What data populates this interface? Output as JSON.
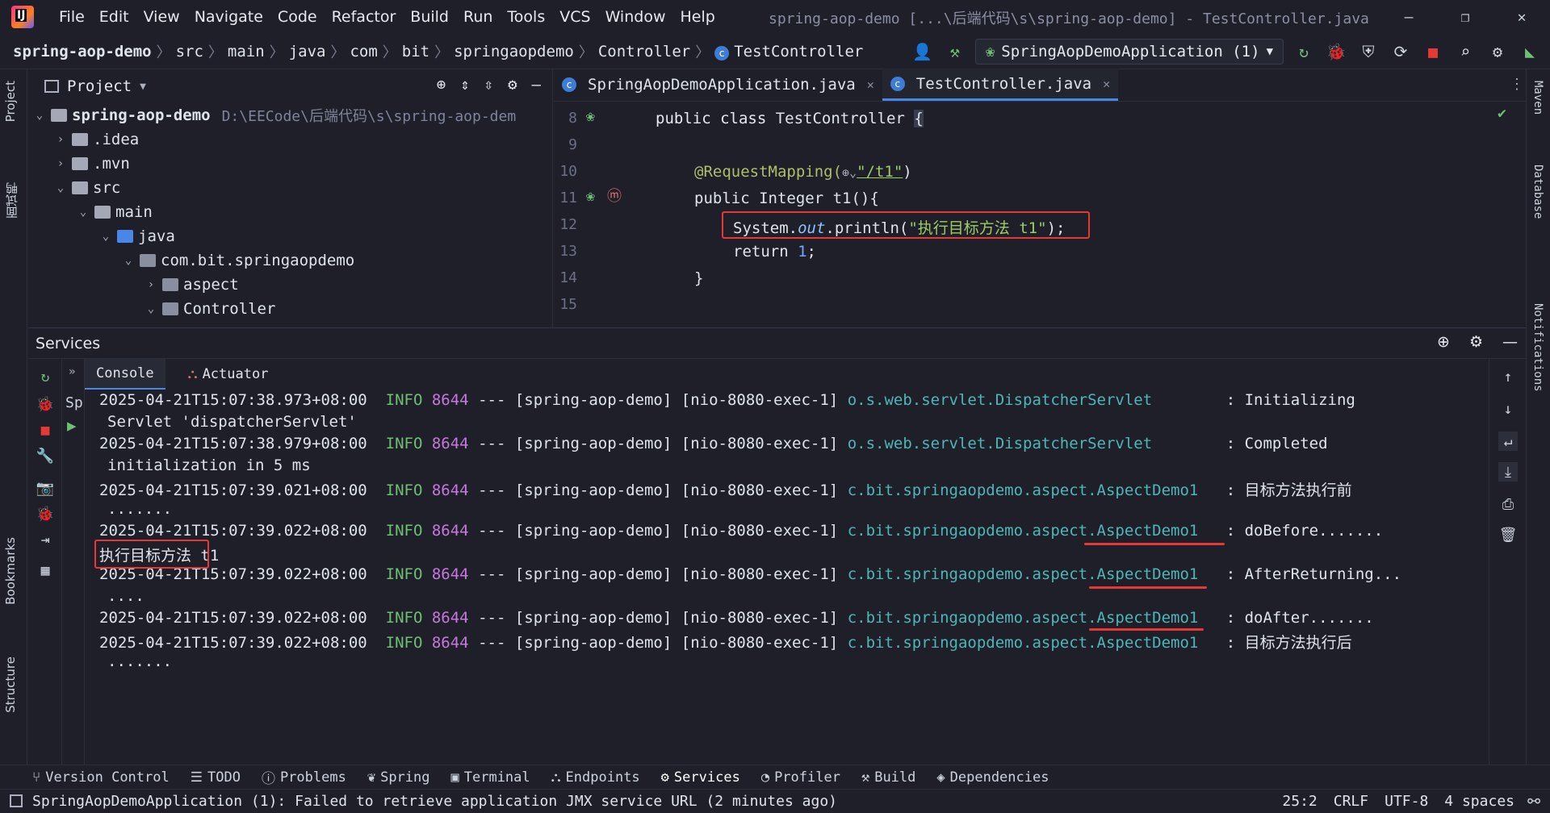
{
  "window": {
    "title": "spring-aop-demo [...\\后端代码\\s\\spring-aop-demo] - TestController.java",
    "menu": [
      "File",
      "Edit",
      "View",
      "Navigate",
      "Code",
      "Refactor",
      "Build",
      "Run",
      "Tools",
      "VCS",
      "Window",
      "Help"
    ]
  },
  "breadcrumb": [
    "spring-aop-demo",
    "src",
    "main",
    "java",
    "com",
    "bit",
    "springaopdemo",
    "Controller",
    "TestController"
  ],
  "toolbar": {
    "run_config": "SpringAopDemoApplication (1)"
  },
  "left_stripe": {
    "project": "Project",
    "interview": "面试鸭",
    "bookmarks": "Bookmarks",
    "structure": "Structure"
  },
  "right_stripe": {
    "maven": "Maven",
    "database": "Database",
    "notifications": "Notifications"
  },
  "project_panel": {
    "title": "Project",
    "root_name": "spring-aop-demo",
    "root_path": "D:\\EECode\\后端代码\\s\\spring-aop-dem",
    "items": [
      ".idea",
      ".mvn",
      "src",
      "main",
      "java",
      "com.bit.springaopdemo",
      "aspect",
      "Controller"
    ]
  },
  "editor": {
    "tabs": [
      "SpringAopDemoApplication.java",
      "TestController.java"
    ],
    "line_numbers": [
      "8",
      "9",
      "10",
      "11",
      "12",
      "13",
      "14",
      "15"
    ],
    "code": {
      "l8_a": "public class ",
      "l8_b": "TestController ",
      "l8_c": "{",
      "l10_a": "@RequestMapping(",
      "l10_b": "\"/t1\"",
      "l10_c": ")",
      "l11_a": "public ",
      "l11_b": "Integer ",
      "l11_c": "t1(){",
      "l12_a": "System.",
      "l12_b": "out",
      "l12_c": ".println(",
      "l12_d": "\"执行目标方法 t1\"",
      "l12_e": ");",
      "l13_a": "return ",
      "l13_b": "1",
      "l13_c": ";",
      "l14": "}"
    }
  },
  "services": {
    "title": "Services",
    "subtabs": [
      "Console",
      "Actuator"
    ],
    "tree_label": "Sp",
    "log": [
      {
        "ts": "2025-04-21T15:07:38.973+08:00",
        "level": "INFO",
        "pid": "8644",
        "sep": "---",
        "app": "[spring-aop-demo]",
        "thread": "[nio-8080-exec-1]",
        "logger": "o.s.web.servlet.DispatcherServlet",
        "msg": ": Initializing",
        "cont": "Servlet 'dispatcherServlet'"
      },
      {
        "ts": "2025-04-21T15:07:38.979+08:00",
        "level": "INFO",
        "pid": "8644",
        "sep": "---",
        "app": "[spring-aop-demo]",
        "thread": "[nio-8080-exec-1]",
        "logger": "o.s.web.servlet.DispatcherServlet",
        "msg": ": Completed",
        "cont": "initialization in 5 ms"
      },
      {
        "ts": "2025-04-21T15:07:39.021+08:00",
        "level": "INFO",
        "pid": "8644",
        "sep": "---",
        "app": "[spring-aop-demo]",
        "thread": "[nio-8080-exec-1]",
        "logger": "c.bit.springaopdemo.aspect.AspectDemo1",
        "msg": ": 目标方法执行前",
        "cont": "......."
      },
      {
        "ts": "2025-04-21T15:07:39.022+08:00",
        "level": "INFO",
        "pid": "8644",
        "sep": "---",
        "app": "[spring-aop-demo]",
        "thread": "[nio-8080-exec-1]",
        "logger": "c.bit.springaopdemo.aspect.AspectDemo1",
        "msg": ": doBefore.......",
        "cont": ""
      },
      {
        "ts": "2025-04-21T15:07:39.022+08:00",
        "level": "INFO",
        "pid": "8644",
        "sep": "---",
        "app": "[spring-aop-demo]",
        "thread": "[nio-8080-exec-1]",
        "logger": "c.bit.springaopdemo.aspect.AspectDemo1",
        "msg": ": AfterReturning...",
        "cont": "...."
      },
      {
        "ts": "2025-04-21T15:07:39.022+08:00",
        "level": "INFO",
        "pid": "8644",
        "sep": "---",
        "app": "[spring-aop-demo]",
        "thread": "[nio-8080-exec-1]",
        "logger": "c.bit.springaopdemo.aspect.AspectDemo1",
        "msg": ": doAfter.......",
        "cont": ""
      },
      {
        "ts": "2025-04-21T15:07:39.022+08:00",
        "level": "INFO",
        "pid": "8644",
        "sep": "---",
        "app": "[spring-aop-demo]",
        "thread": "[nio-8080-exec-1]",
        "logger": "c.bit.springaopdemo.aspect.AspectDemo1",
        "msg": ": 目标方法执行后",
        "cont": "......."
      }
    ],
    "println_output": "执行目标方法 t1"
  },
  "bottom_tabs": [
    "Version Control",
    "TODO",
    "Problems",
    "Spring",
    "Terminal",
    "Endpoints",
    "Services",
    "Profiler",
    "Build",
    "Dependencies"
  ],
  "status": {
    "message": "SpringAopDemoApplication (1): Failed to retrieve application JMX service URL (2 minutes ago)",
    "position": "25:2",
    "line_sep": "CRLF",
    "encoding": "UTF-8",
    "indent": "4 spaces"
  },
  "colors": {
    "highlight_red": "#e53935",
    "accent_blue": "#4a86e8",
    "info_green": "#6fbf73",
    "logger_teal": "#4fb6b8"
  }
}
